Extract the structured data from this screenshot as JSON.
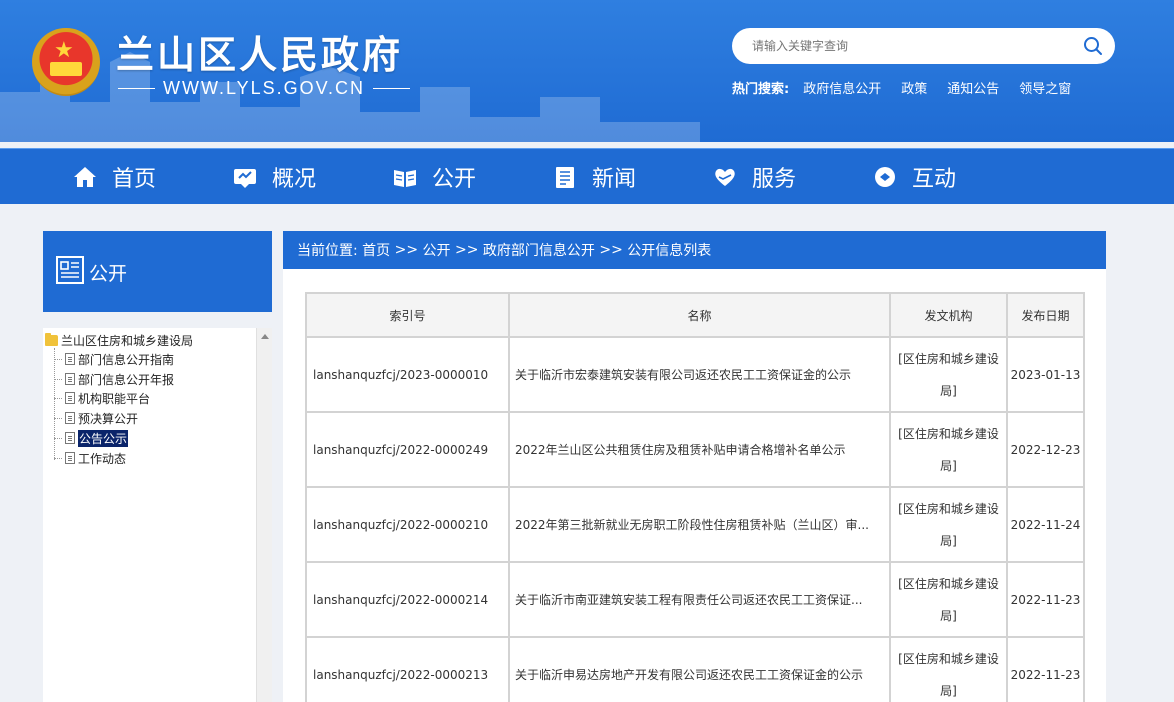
{
  "header": {
    "site_title": "兰山区人民政府",
    "site_url": "WWW.LYLS.GOV.CN",
    "search_placeholder": "请输入关键字查询",
    "hot_label": "热门搜索:",
    "hot_links": [
      "政府信息公开",
      "政策",
      "通知公告",
      "领导之窗"
    ]
  },
  "nav": {
    "items": [
      {
        "label": "首页",
        "icon": "home-icon"
      },
      {
        "label": "概况",
        "icon": "overview-icon"
      },
      {
        "label": "公开",
        "icon": "book-icon"
      },
      {
        "label": "新闻",
        "icon": "news-icon"
      },
      {
        "label": "服务",
        "icon": "heart-hand-icon"
      },
      {
        "label": "互动",
        "icon": "chat-icon"
      }
    ]
  },
  "sidebar": {
    "title": "公开",
    "tree_root": "兰山区住房和城乡建设局",
    "tree_items": [
      "部门信息公开指南",
      "部门信息公开年报",
      "机构职能平台",
      "预决算公开",
      "公告公示",
      "工作动态"
    ],
    "selected_index": 4
  },
  "breadcrumb": {
    "prefix": "当前位置:",
    "items": [
      "首页",
      "公开",
      "政府部门信息公开",
      "公开信息列表"
    ],
    "separator": ">>"
  },
  "table": {
    "headers": [
      "索引号",
      "名称",
      "发文机构",
      "发布日期"
    ],
    "rows": [
      {
        "index": "lanshanquzfcj/2023-0000010",
        "title": "关于临沂市宏泰建筑安装有限公司返还农民工工资保证金的公示",
        "org_line1": "[区住房和城乡建设",
        "org_line2": "局]",
        "date": "2023-01-13"
      },
      {
        "index": "lanshanquzfcj/2022-0000249",
        "title": "2022年兰山区公共租赁住房及租赁补贴申请合格增补名单公示",
        "org_line1": "[区住房和城乡建设",
        "org_line2": "局]",
        "date": "2022-12-23"
      },
      {
        "index": "lanshanquzfcj/2022-0000210",
        "title": "2022年第三批新就业无房职工阶段性住房租赁补贴（兰山区）审...",
        "org_line1": "[区住房和城乡建设",
        "org_line2": "局]",
        "date": "2022-11-24"
      },
      {
        "index": "lanshanquzfcj/2022-0000214",
        "title": "关于临沂市南亚建筑安装工程有限责任公司返还农民工工资保证...",
        "org_line1": "[区住房和城乡建设",
        "org_line2": "局]",
        "date": "2022-11-23"
      },
      {
        "index": "lanshanquzfcj/2022-0000213",
        "title": "关于临沂申易达房地产开发有限公司返还农民工工资保证金的公示",
        "org_line1": "[区住房和城乡建设",
        "org_line2": "局]",
        "date": "2022-11-23"
      }
    ]
  },
  "colors": {
    "primary": "#1f6bd3",
    "header_top": "#2f7fe0",
    "page_bg": "#eef1f6"
  }
}
